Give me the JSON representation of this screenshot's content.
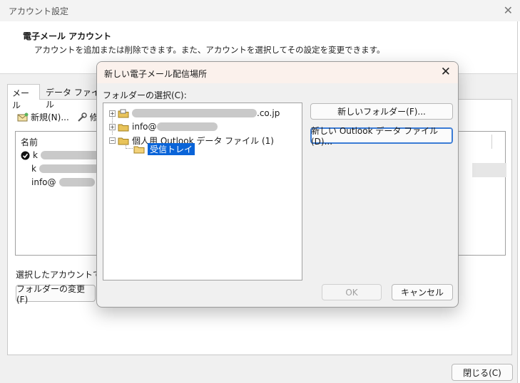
{
  "window": {
    "title": "アカウント設定",
    "close_glyph": "✕",
    "header_title": "電子メール アカウント",
    "header_desc": "アカウントを追加または削除できます。また、アカウントを選択してその設定を変更できます。"
  },
  "tabs": [
    {
      "label": "メール"
    },
    {
      "label": "データ ファイル"
    }
  ],
  "toolbar": {
    "new_label": "新規(N)...",
    "repair_label": "修"
  },
  "account_list": {
    "header": "名前",
    "rows": [
      {
        "text": "k"
      },
      {
        "text": "k"
      },
      {
        "text": "info@"
      }
    ]
  },
  "selection_text": "選択したアカウントでは、",
  "change_folder_button": "フォルダーの変更(F)",
  "close_button": "閉じる(C)",
  "dialog": {
    "title": "新しい電子メール配信場所",
    "close_glyph": "✕",
    "folder_label": "フォルダーの選択(C):",
    "tree": [
      {
        "text": ".co.jp",
        "expander": "+"
      },
      {
        "text": "info@",
        "expander": "+"
      },
      {
        "text": "個人用 Outlook データ ファイル (1)",
        "expander": "−"
      },
      {
        "text": "受信トレイ"
      }
    ],
    "new_folder_button": "新しいフォルダー(F)...",
    "new_data_file_button": "新しい Outlook データ ファイル(D)...",
    "ok_button": "OK",
    "cancel_button": "キャンセル"
  },
  "colors": {
    "selection": "#0a64d8",
    "accent_border": "#3a7bd5",
    "folder": "#e8c35a"
  }
}
